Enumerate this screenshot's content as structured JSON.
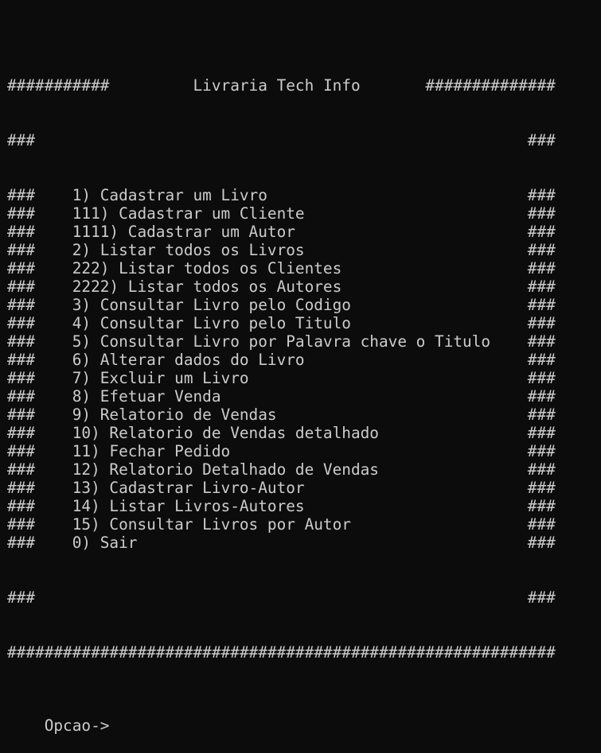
{
  "header": {
    "left_hashes": "###########",
    "title": "Livraria Tech Info",
    "right_hashes": "##############"
  },
  "border": {
    "side": "###",
    "full_line": "###########################################################"
  },
  "menu": {
    "items": [
      "1) Cadastrar um Livro",
      "111) Cadastrar um Cliente",
      "1111) Cadastrar um Autor",
      "2) Listar todos os Livros",
      "222) Listar todos os Clientes",
      "2222) Listar todos os Autores",
      "3) Consultar Livro pelo Codigo",
      "4) Consultar Livro pelo Titulo",
      "5) Consultar Livro por Palavra chave o Titulo",
      "6) Alterar dados do Livro",
      "7) Excluir um Livro",
      "8) Efetuar Venda",
      "9) Relatorio de Vendas",
      "10) Relatorio de Vendas detalhado",
      "11) Fechar Pedido",
      "12) Relatorio Detalhado de Vendas",
      "13) Cadastrar Livro-Autor",
      "14) Listar Livros-Autores",
      "15) Consultar Livros por Autor",
      "0) Sair"
    ]
  },
  "prompt": {
    "label": "Opcao->",
    "value": ""
  }
}
